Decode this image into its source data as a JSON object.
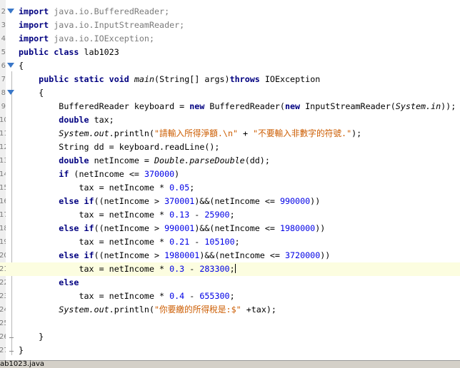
{
  "editor": {
    "current_line": 21,
    "lines": [
      {
        "num": "2",
        "fold": "collapse",
        "tokens": [
          {
            "t": "import",
            "c": "kw"
          },
          {
            "t": " java.io.BufferedReader;",
            "c": "imp"
          }
        ]
      },
      {
        "num": "3",
        "fold": "",
        "tokens": [
          {
            "t": "import",
            "c": "kw"
          },
          {
            "t": " java.io.InputStreamReader;",
            "c": "imp"
          }
        ]
      },
      {
        "num": "4",
        "fold": "",
        "tokens": [
          {
            "t": "import",
            "c": "kw"
          },
          {
            "t": " java.io.IOException;",
            "c": "imp"
          }
        ]
      },
      {
        "num": "5",
        "fold": "",
        "tokens": [
          {
            "t": "public class",
            "c": "kw"
          },
          {
            "t": " lab1023",
            "c": ""
          }
        ]
      },
      {
        "num": "6",
        "fold": "collapse",
        "tokens": [
          {
            "t": "{",
            "c": ""
          }
        ]
      },
      {
        "num": "7",
        "fold": "",
        "tokens": [
          {
            "t": "    ",
            "c": ""
          },
          {
            "t": "public static void",
            "c": "kw"
          },
          {
            "t": " ",
            "c": ""
          },
          {
            "t": "main",
            "c": "it"
          },
          {
            "t": "(String[] args)",
            "c": ""
          },
          {
            "t": "throws",
            "c": "kw"
          },
          {
            "t": " IOException",
            "c": ""
          }
        ]
      },
      {
        "num": "8",
        "fold": "collapse",
        "tokens": [
          {
            "t": "    {",
            "c": ""
          }
        ]
      },
      {
        "num": "9",
        "fold": "",
        "tokens": [
          {
            "t": "        BufferedReader keyboard = ",
            "c": ""
          },
          {
            "t": "new",
            "c": "kw"
          },
          {
            "t": " BufferedReader(",
            "c": ""
          },
          {
            "t": "new",
            "c": "kw"
          },
          {
            "t": " InputStreamReader(",
            "c": ""
          },
          {
            "t": "System.in",
            "c": "it"
          },
          {
            "t": "));",
            "c": ""
          }
        ]
      },
      {
        "num": "10",
        "fold": "",
        "tokens": [
          {
            "t": "        ",
            "c": ""
          },
          {
            "t": "double",
            "c": "kw"
          },
          {
            "t": " tax;",
            "c": ""
          }
        ]
      },
      {
        "num": "11",
        "fold": "",
        "tokens": [
          {
            "t": "        ",
            "c": ""
          },
          {
            "t": "System.out",
            "c": "it"
          },
          {
            "t": ".println(",
            "c": ""
          },
          {
            "t": "\"請輸入所得淨額.\\n\"",
            "c": "str"
          },
          {
            "t": " + ",
            "c": ""
          },
          {
            "t": "\"不要輸入非數字的符號.\"",
            "c": "str"
          },
          {
            "t": ");",
            "c": ""
          }
        ]
      },
      {
        "num": "12",
        "fold": "",
        "tokens": [
          {
            "t": "        String dd = keyboard.readLine();",
            "c": ""
          }
        ]
      },
      {
        "num": "13",
        "fold": "",
        "tokens": [
          {
            "t": "        ",
            "c": ""
          },
          {
            "t": "double",
            "c": "kw"
          },
          {
            "t": " netIncome = ",
            "c": ""
          },
          {
            "t": "Double.parseDouble",
            "c": "it"
          },
          {
            "t": "(dd);",
            "c": ""
          }
        ]
      },
      {
        "num": "14",
        "fold": "",
        "tokens": [
          {
            "t": "        ",
            "c": ""
          },
          {
            "t": "if",
            "c": "kw"
          },
          {
            "t": " (netIncome <= ",
            "c": ""
          },
          {
            "t": "370000",
            "c": "num"
          },
          {
            "t": ")",
            "c": ""
          }
        ]
      },
      {
        "num": "15",
        "fold": "",
        "tokens": [
          {
            "t": "            tax = netIncome * ",
            "c": ""
          },
          {
            "t": "0.05",
            "c": "num"
          },
          {
            "t": ";",
            "c": ""
          }
        ]
      },
      {
        "num": "16",
        "fold": "",
        "tokens": [
          {
            "t": "        ",
            "c": ""
          },
          {
            "t": "else if",
            "c": "kw"
          },
          {
            "t": "((netIncome > ",
            "c": ""
          },
          {
            "t": "370001",
            "c": "num"
          },
          {
            "t": ")&&(netIncome <= ",
            "c": ""
          },
          {
            "t": "990000",
            "c": "num"
          },
          {
            "t": "))",
            "c": ""
          }
        ]
      },
      {
        "num": "17",
        "fold": "",
        "tokens": [
          {
            "t": "            tax = netIncome * ",
            "c": ""
          },
          {
            "t": "0.13",
            "c": "num"
          },
          {
            "t": " - ",
            "c": ""
          },
          {
            "t": "25900",
            "c": "num"
          },
          {
            "t": ";",
            "c": ""
          }
        ]
      },
      {
        "num": "18",
        "fold": "",
        "tokens": [
          {
            "t": "        ",
            "c": ""
          },
          {
            "t": "else if",
            "c": "kw"
          },
          {
            "t": "((netIncome > ",
            "c": ""
          },
          {
            "t": "990001",
            "c": "num"
          },
          {
            "t": ")&&(netIncome <= ",
            "c": ""
          },
          {
            "t": "1980000",
            "c": "num"
          },
          {
            "t": "))",
            "c": ""
          }
        ]
      },
      {
        "num": "19",
        "fold": "",
        "tokens": [
          {
            "t": "            tax = netIncome * ",
            "c": ""
          },
          {
            "t": "0.21",
            "c": "num"
          },
          {
            "t": " - ",
            "c": ""
          },
          {
            "t": "105100",
            "c": "num"
          },
          {
            "t": ";",
            "c": ""
          }
        ]
      },
      {
        "num": "20",
        "fold": "",
        "tokens": [
          {
            "t": "        ",
            "c": ""
          },
          {
            "t": "else if",
            "c": "kw"
          },
          {
            "t": "((netIncome > ",
            "c": ""
          },
          {
            "t": "1980001",
            "c": "num"
          },
          {
            "t": ")&&(netIncome <= ",
            "c": ""
          },
          {
            "t": "3720000",
            "c": "num"
          },
          {
            "t": "))",
            "c": ""
          }
        ]
      },
      {
        "num": "21",
        "fold": "",
        "tokens": [
          {
            "t": "            tax = netIncome * ",
            "c": ""
          },
          {
            "t": "0.3",
            "c": "num"
          },
          {
            "t": " - ",
            "c": ""
          },
          {
            "t": "283300",
            "c": "num"
          },
          {
            "t": ";",
            "c": ""
          }
        ]
      },
      {
        "num": "22",
        "fold": "",
        "tokens": [
          {
            "t": "        ",
            "c": ""
          },
          {
            "t": "else",
            "c": "kw"
          }
        ]
      },
      {
        "num": "23",
        "fold": "",
        "tokens": [
          {
            "t": "            tax = netIncome * ",
            "c": ""
          },
          {
            "t": "0.4",
            "c": "num"
          },
          {
            "t": " - ",
            "c": ""
          },
          {
            "t": "655300",
            "c": "num"
          },
          {
            "t": ";",
            "c": ""
          }
        ]
      },
      {
        "num": "24",
        "fold": "",
        "tokens": [
          {
            "t": "        ",
            "c": ""
          },
          {
            "t": "System.out",
            "c": "it"
          },
          {
            "t": ".println(",
            "c": ""
          },
          {
            "t": "\"你要繳的所得稅是:$\"",
            "c": "str"
          },
          {
            "t": " +tax);",
            "c": ""
          }
        ]
      },
      {
        "num": "25",
        "fold": "",
        "tokens": []
      },
      {
        "num": "26",
        "fold": "end",
        "tokens": [
          {
            "t": "    }",
            "c": ""
          }
        ]
      },
      {
        "num": "27",
        "fold": "end",
        "tokens": [
          {
            "t": "}",
            "c": ""
          }
        ]
      }
    ]
  },
  "status": {
    "file_tab": "ab1023.java"
  }
}
